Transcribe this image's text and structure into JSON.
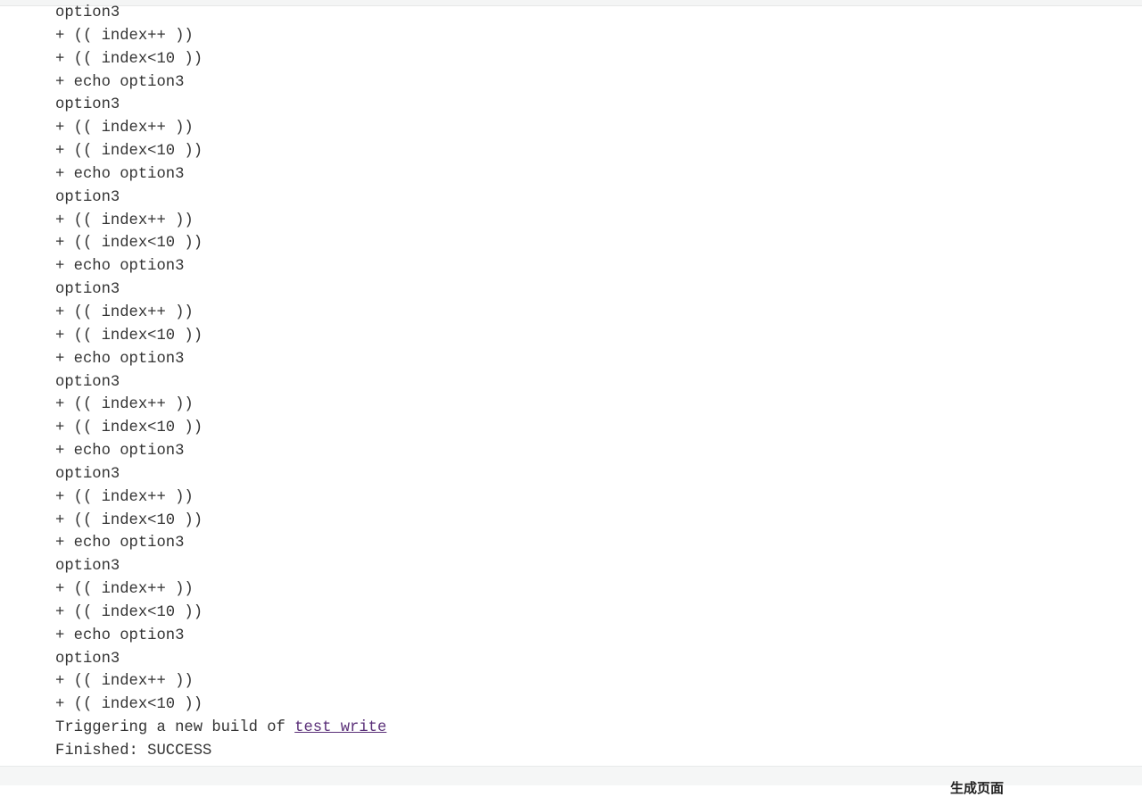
{
  "console": {
    "lines": [
      "option3",
      "+ (( index++ ))",
      "+ (( index<10 ))",
      "+ echo option3",
      "option3",
      "+ (( index++ ))",
      "+ (( index<10 ))",
      "+ echo option3",
      "option3",
      "+ (( index++ ))",
      "+ (( index<10 ))",
      "+ echo option3",
      "option3",
      "+ (( index++ ))",
      "+ (( index<10 ))",
      "+ echo option3",
      "option3",
      "+ (( index++ ))",
      "+ (( index<10 ))",
      "+ echo option3",
      "option3",
      "+ (( index++ ))",
      "+ (( index<10 ))",
      "+ echo option3",
      "option3",
      "+ (( index++ ))",
      "+ (( index<10 ))",
      "+ echo option3",
      "option3",
      "+ (( index++ ))",
      "+ (( index<10 ))"
    ],
    "trigger_prefix": "Triggering a new build of ",
    "trigger_link": "test_write",
    "finished": "Finished: SUCCESS"
  },
  "footer": {
    "text": "生成页面"
  },
  "colors": {
    "link": "#5a2f78",
    "text": "#333333"
  }
}
